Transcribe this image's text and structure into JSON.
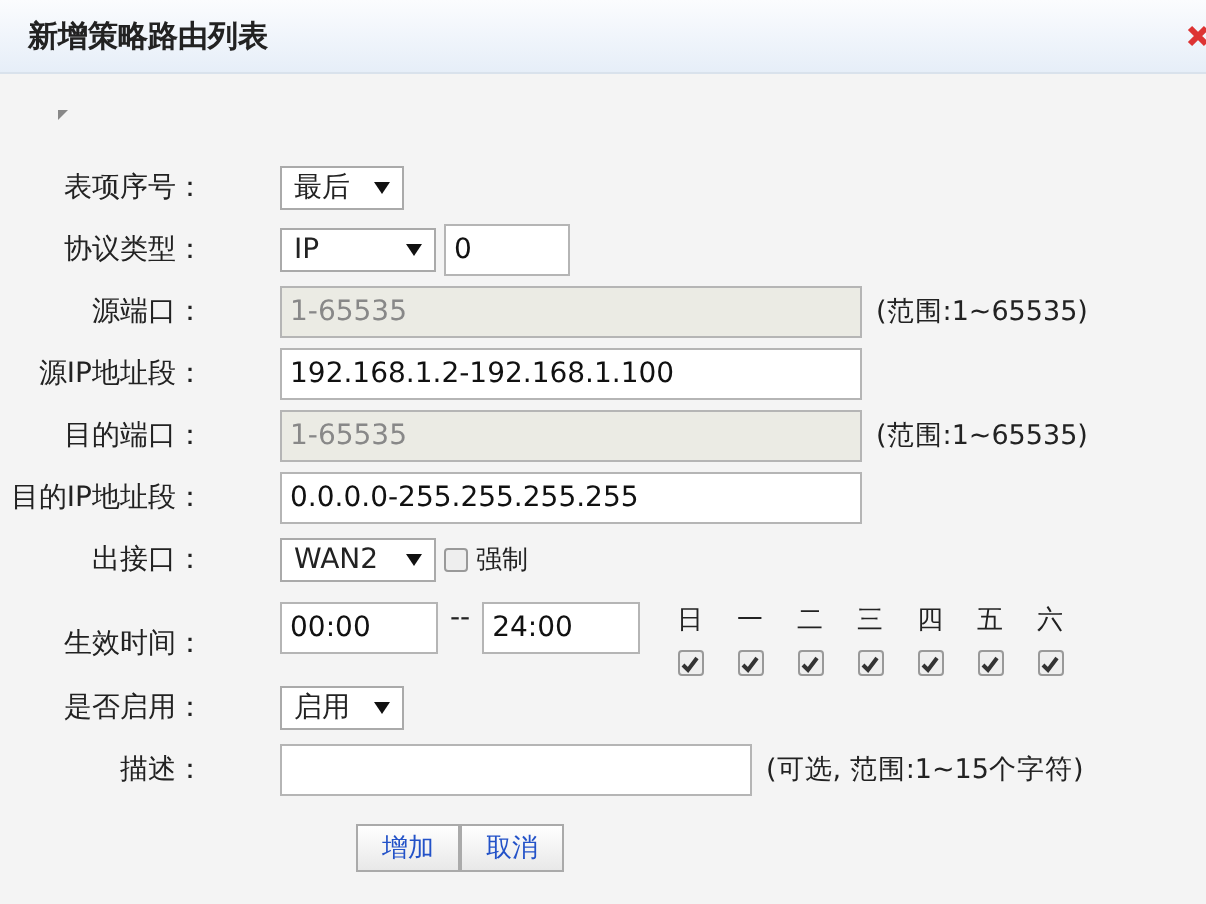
{
  "dialog": {
    "title": "新增策略路由列表"
  },
  "fields": [
    {
      "kind": "select",
      "label": "表项序号：",
      "value": "最后"
    },
    {
      "kind": "select_input",
      "label": "协议类型：",
      "value": "IP",
      "input": "0"
    },
    {
      "kind": "text",
      "label": "源端口：",
      "value": "1-65535",
      "disabled": true,
      "hint": "(范围:1~65535)"
    },
    {
      "kind": "text",
      "label": "源IP地址段：",
      "value": "192.168.1.2-192.168.1.100",
      "disabled": false
    },
    {
      "kind": "text",
      "label": "目的端口：",
      "value": "1-65535",
      "disabled": true,
      "hint": "(范围:1~65535)"
    },
    {
      "kind": "text",
      "label": "目的IP地址段：",
      "value": "0.0.0.0-255.255.255.255",
      "disabled": false
    },
    {
      "kind": "select_check",
      "label": "出接口：",
      "value": "WAN2",
      "check": {
        "label": "强制",
        "checked": false
      }
    },
    {
      "kind": "time",
      "label": "生效时间：",
      "start": "00:00",
      "separator": "--",
      "end": "24:00",
      "days": [
        {
          "label": "日",
          "checked": true
        },
        {
          "label": "一",
          "checked": true
        },
        {
          "label": "二",
          "checked": true
        },
        {
          "label": "三",
          "checked": true
        },
        {
          "label": "四",
          "checked": true
        },
        {
          "label": "五",
          "checked": true
        },
        {
          "label": "六",
          "checked": true
        }
      ]
    },
    {
      "kind": "select",
      "label": "是否启用：",
      "value": "启用"
    },
    {
      "kind": "text",
      "label": "描述：",
      "disabled": false,
      "short": true,
      "hint": "(可选, 范围:1~15个字符)"
    }
  ],
  "buttons": [
    "增加",
    "取消"
  ]
}
